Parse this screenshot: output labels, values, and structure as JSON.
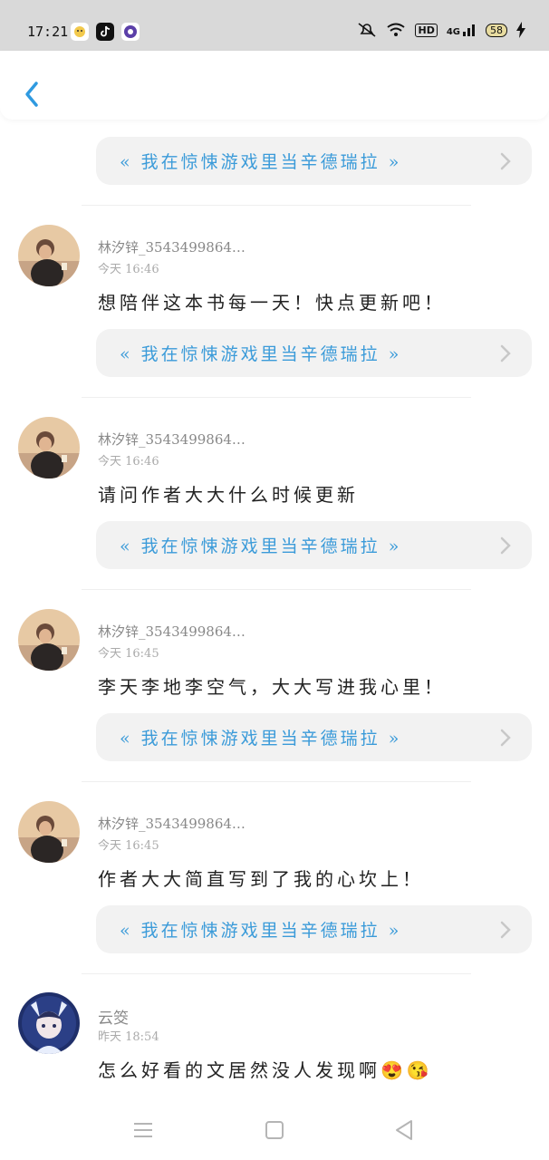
{
  "status_bar": {
    "time": "17:21",
    "network_badge": "HD",
    "signal_label": "4G",
    "battery": "58",
    "icons": [
      "app-icon-yellow-bird",
      "tiktok-icon",
      "app-icon-purple",
      "mute-icon",
      "wifi-icon",
      "signal-icon",
      "charging-icon"
    ]
  },
  "header": {
    "back_icon": "chevron-left-icon"
  },
  "book_link": {
    "title": "« 我在惊悚游戏里当辛德瑞拉 »"
  },
  "comments": [
    {
      "username": "林汐锌_3543499864…",
      "time": "今天 16:46",
      "text": "想陪伴这本书每一天！快点更新吧！"
    },
    {
      "username": "林汐锌_3543499864…",
      "time": "今天 16:46",
      "text": "请问作者大大什么时候更新"
    },
    {
      "username": "林汐锌_3543499864…",
      "time": "今天 16:45",
      "text": "李天李地李空气，大大写进我心里！"
    },
    {
      "username": "林汐锌_3543499864…",
      "time": "今天 16:45",
      "text": "作者大大简直写到了我的心坎上！"
    },
    {
      "username": "云筊",
      "time": "昨天 18:54",
      "text": "怎么好看的文居然没人发现啊😍😘"
    }
  ],
  "colors": {
    "accent": "#3b9bd9",
    "card_bg": "#f2f2f2",
    "status_bg": "#d9d9d9"
  }
}
